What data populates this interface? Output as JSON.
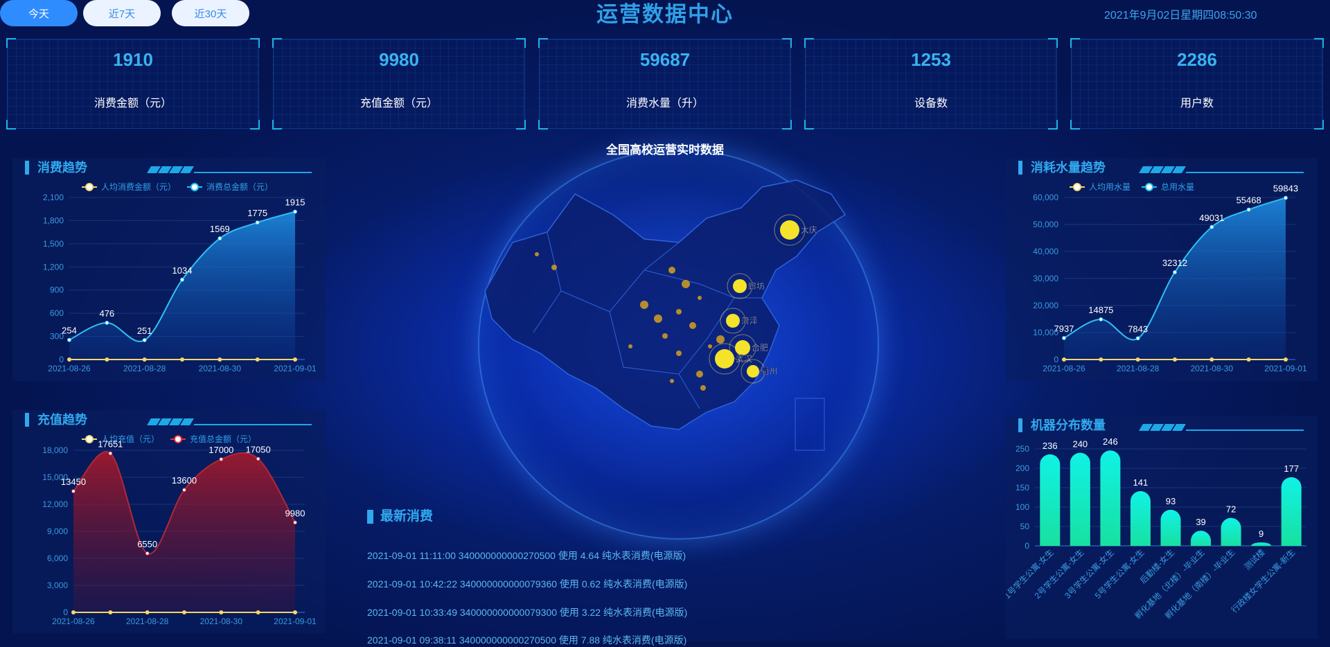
{
  "header": {
    "tabs": [
      {
        "label": "今天",
        "active": true
      },
      {
        "label": "近7天",
        "active": false
      },
      {
        "label": "近30天",
        "active": false
      }
    ],
    "title": "运营数据中心",
    "datetime": "2021年9月02日星期四08:50:30"
  },
  "stats": [
    {
      "value": "1910",
      "label": "消费金额（元）"
    },
    {
      "value": "9980",
      "label": "充值金额（元）"
    },
    {
      "value": "59687",
      "label": "消费水量（升）"
    },
    {
      "value": "1253",
      "label": "设备数"
    },
    {
      "value": "2286",
      "label": "用户数"
    }
  ],
  "map": {
    "title": "全国高校运营实时数据",
    "cities": [
      "大庆",
      "廊坊",
      "菏泽",
      "合肥",
      "武汉",
      "衢州"
    ]
  },
  "recent": {
    "title": "最新消费",
    "items": [
      "2021-09-01 11:11:00 340000000000270500 使用 4.64 纯水表消费(电源版)",
      "2021-09-01 10:42:22 340000000000079360 使用 0.62 纯水表消费(电源版)",
      "2021-09-01 10:33:49 340000000000079300 使用 3.22 纯水表消费(电源版)",
      "2021-09-01 09:38:11 340000000000270500 使用 7.88 纯水表消费(电源版)"
    ]
  },
  "colors": {
    "accent": "#31a9ee",
    "gold": "#f5d76e",
    "cyan": "#19c8ff",
    "red_area": "#8e1a2a",
    "bar_top": "#10f2e6",
    "bar_bottom": "#18e0a0"
  },
  "chart_data": [
    {
      "id": "consume",
      "type": "area",
      "title": "消费趋势",
      "x": [
        "2021-08-26",
        "2021-08-27",
        "2021-08-28",
        "2021-08-29",
        "2021-08-30",
        "2021-08-31",
        "2021-09-01"
      ],
      "xticks": [
        "2021-08-26",
        "2021-08-28",
        "2021-08-30",
        "2021-09-01"
      ],
      "ylim": [
        0,
        2100
      ],
      "yticks": [
        0,
        300,
        600,
        900,
        1200,
        1500,
        1800,
        2100
      ],
      "yticklabels": [
        "0",
        "300",
        "600",
        "900",
        "1,200",
        "1,500",
        "1,800",
        "2,100"
      ],
      "xpos": [
        0,
        1,
        2,
        3,
        4,
        5,
        6
      ],
      "series": [
        {
          "name": "人均消费金额（元）",
          "values": [
            0,
            0,
            0,
            0,
            0,
            0,
            0
          ],
          "labels": false
        },
        {
          "name": "消费总金额（元）",
          "values": [
            254,
            476,
            251,
            1034,
            1569,
            1775,
            1915
          ],
          "labels": true
        }
      ]
    },
    {
      "id": "water",
      "type": "area",
      "title": "消耗水量趋势",
      "x": [
        "2021-08-26",
        "2021-08-27",
        "2021-08-28",
        "2021-08-29",
        "2021-08-30",
        "2021-08-31",
        "2021-09-01"
      ],
      "xticks": [
        "2021-08-26",
        "2021-08-28",
        "2021-08-30",
        "2021-09-01"
      ],
      "ylim": [
        0,
        60000
      ],
      "yticks": [
        0,
        10000,
        20000,
        30000,
        40000,
        50000,
        60000
      ],
      "yticklabels": [
        "0",
        "10,000",
        "20,000",
        "30,000",
        "40,000",
        "50,000",
        "60,000"
      ],
      "series": [
        {
          "name": "人均用水量",
          "values": [
            0,
            0,
            0,
            0,
            0,
            0,
            0
          ],
          "labels": false
        },
        {
          "name": "总用水量",
          "values": [
            7937,
            14875,
            7843,
            32312,
            49031,
            55468,
            59843
          ],
          "labels": true
        }
      ]
    },
    {
      "id": "recharge",
      "type": "area",
      "title": "充值趋势",
      "x": [
        "2021-08-26",
        "2021-08-27",
        "2021-08-28",
        "2021-08-29",
        "2021-08-30",
        "2021-08-31",
        "2021-09-01"
      ],
      "xticks": [
        "2021-08-26",
        "2021-08-28",
        "2021-08-30",
        "2021-09-01"
      ],
      "ylim": [
        0,
        18000
      ],
      "yticks": [
        0,
        3000,
        6000,
        9000,
        12000,
        15000,
        18000
      ],
      "yticklabels": [
        "0",
        "3,000",
        "6,000",
        "9,000",
        "12,000",
        "15,000",
        "18,000"
      ],
      "series": [
        {
          "name": "人均充值（元）",
          "values": [
            0,
            0,
            0,
            0,
            0,
            0,
            0
          ],
          "labels": false
        },
        {
          "name": "充值总金额（元）",
          "values": [
            13450,
            17651,
            6550,
            13600,
            17000,
            17050,
            9980
          ],
          "labels": true
        }
      ]
    },
    {
      "id": "machines",
      "type": "bar",
      "title": "机器分布数量",
      "categories": [
        "1号学生公寓-女生",
        "2号学生公寓-女生",
        "3号学生公寓-女生",
        "5号学生公寓-女生",
        "后勤楼-女生",
        "孵化基地（北楼）-毕业生",
        "孵化基地（南楼）-毕业生",
        "测试楼",
        "行政楼女学生公寓-新生"
      ],
      "values": [
        236,
        240,
        246,
        141,
        93,
        39,
        72,
        9,
        177
      ],
      "ylim": [
        0,
        250
      ],
      "yticks": [
        0,
        50,
        100,
        150,
        200,
        250
      ]
    }
  ]
}
